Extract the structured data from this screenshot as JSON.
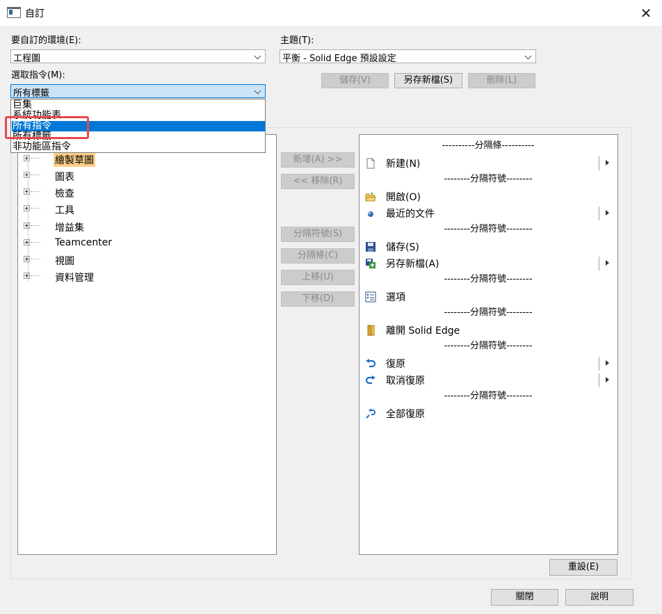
{
  "window": {
    "title": "自訂",
    "close_glyph": "✕"
  },
  "environment": {
    "label": "要自訂的環境(E):",
    "value": "工程圖"
  },
  "theme": {
    "label": "主題(T):",
    "value": "平衡 - Solid Edge 預設設定"
  },
  "theme_buttons": {
    "save": "儲存(V)",
    "save_as": "另存新檔(S)",
    "delete": "刪除(L)"
  },
  "select_command": {
    "label": "選取指令(M):",
    "value": "所有標籤",
    "options": [
      "巨集",
      "系統功能表",
      "所有指令",
      "所有標籤",
      "非功能區指令"
    ],
    "highlighted_option": "所有指令"
  },
  "tree": {
    "items": [
      "繪製草圖",
      "圖表",
      "檢查",
      "工具",
      "增益集",
      "Teamcenter",
      "視圖",
      "資料管理"
    ],
    "selected": "繪製草圖"
  },
  "middle_buttons": {
    "add": "新增(A) >>",
    "remove": "<< 移除(R)",
    "separator_symbol": "分隔符號(S)",
    "separator_bar": "分隔條(C)",
    "move_up": "上移(U)",
    "move_down": "下移(D)"
  },
  "command_list": [
    {
      "kind": "sep",
      "text": "----------分隔條----------"
    },
    {
      "kind": "cmd",
      "text": "新建(N)",
      "icon": "new-document-icon",
      "submenu": true
    },
    {
      "kind": "sep",
      "text": "--------分隔符號--------"
    },
    {
      "kind": "cmd",
      "text": "開啟(O)",
      "icon": "open-folder-icon",
      "submenu": false
    },
    {
      "kind": "cmd",
      "text": "最近的文件",
      "icon": "recent-documents-icon",
      "submenu": true
    },
    {
      "kind": "sep",
      "text": "--------分隔符號--------"
    },
    {
      "kind": "cmd",
      "text": "儲存(S)",
      "icon": "save-disk-icon",
      "submenu": false
    },
    {
      "kind": "cmd",
      "text": "另存新檔(A)",
      "icon": "save-as-icon",
      "submenu": true
    },
    {
      "kind": "sep",
      "text": "--------分隔符號--------"
    },
    {
      "kind": "cmd",
      "text": "選項",
      "icon": "options-list-icon",
      "submenu": false
    },
    {
      "kind": "sep",
      "text": "--------分隔符號--------"
    },
    {
      "kind": "cmd",
      "text": "離開 Solid Edge",
      "icon": "exit-door-icon",
      "submenu": false
    },
    {
      "kind": "sep",
      "text": "--------分隔符號--------"
    },
    {
      "kind": "cmd",
      "text": "復原",
      "icon": "undo-icon",
      "submenu": true
    },
    {
      "kind": "cmd",
      "text": "取消復原",
      "icon": "redo-icon",
      "submenu": true
    },
    {
      "kind": "sep",
      "text": "--------分隔符號--------"
    },
    {
      "kind": "cmd",
      "text": "全部復原",
      "icon": "undo-all-icon",
      "submenu": false
    }
  ],
  "reset_button": "重設(E)",
  "footer": {
    "close": "關閉",
    "help": "說明"
  }
}
